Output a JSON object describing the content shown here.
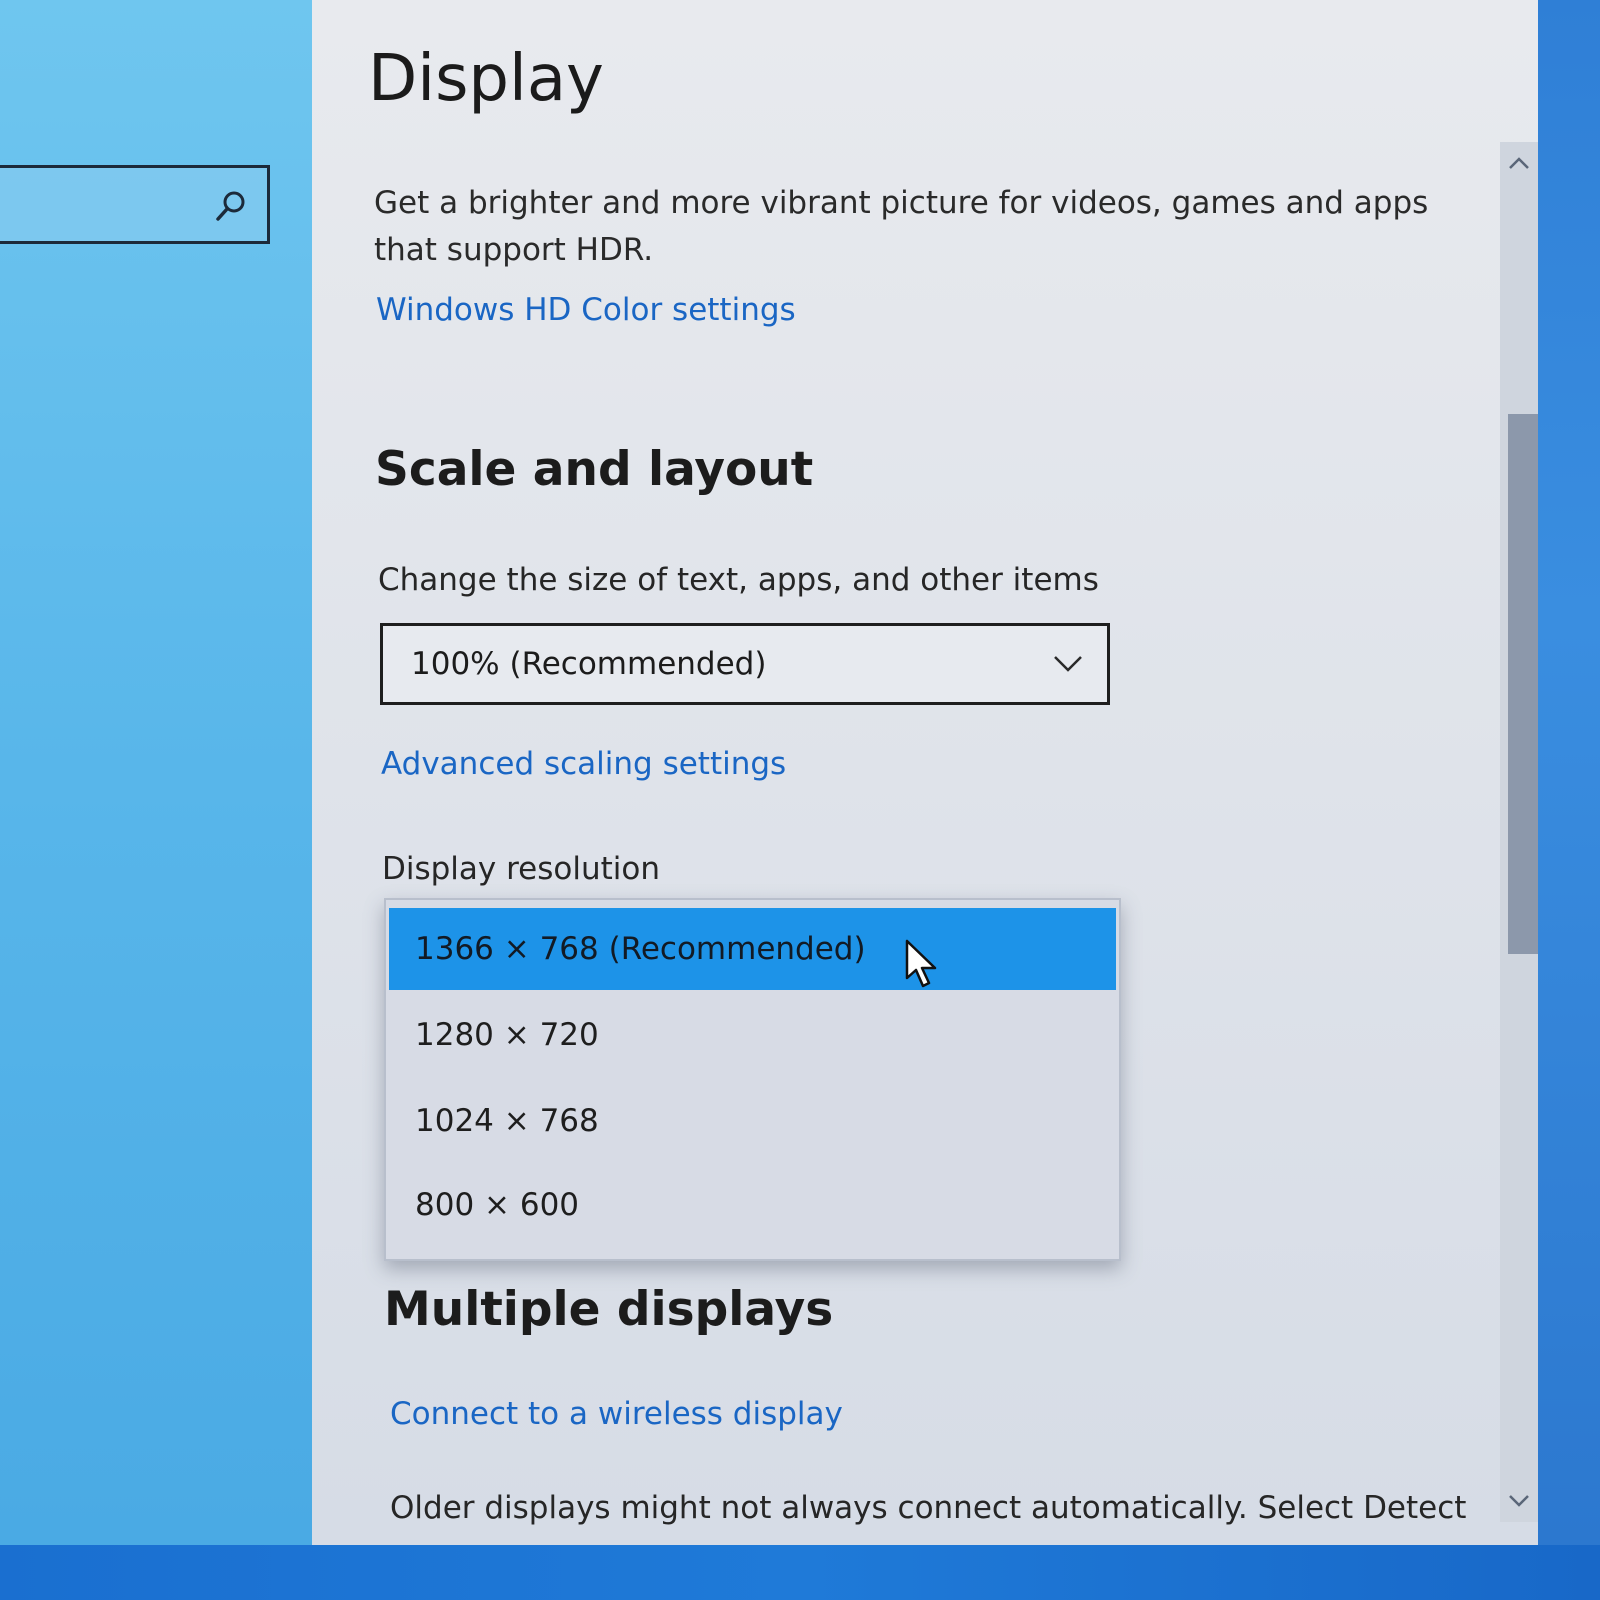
{
  "page": {
    "title": "Display"
  },
  "hdr": {
    "description": "Get a brighter and more vibrant picture for videos, games and apps that support HDR.",
    "link": "Windows HD Color settings"
  },
  "scale_layout": {
    "heading": "Scale and layout",
    "size_label": "Change the size of text, apps, and other items",
    "size_value": "100% (Recommended)",
    "advanced_link": "Advanced scaling settings",
    "resolution_label": "Display resolution",
    "resolution_options": [
      "1366 × 768 (Recommended)",
      "1280 × 720",
      "1024 × 768",
      "800 × 600"
    ],
    "selected_resolution": "1366 × 768 (Recommended)"
  },
  "multiple_displays": {
    "heading": "Multiple displays",
    "wireless_link": "Connect to a wireless display",
    "footer_text": "Older displays might not always connect automatically. Select Detect"
  },
  "colors": {
    "accent": "#1d93e8",
    "link": "#1a66c4"
  }
}
